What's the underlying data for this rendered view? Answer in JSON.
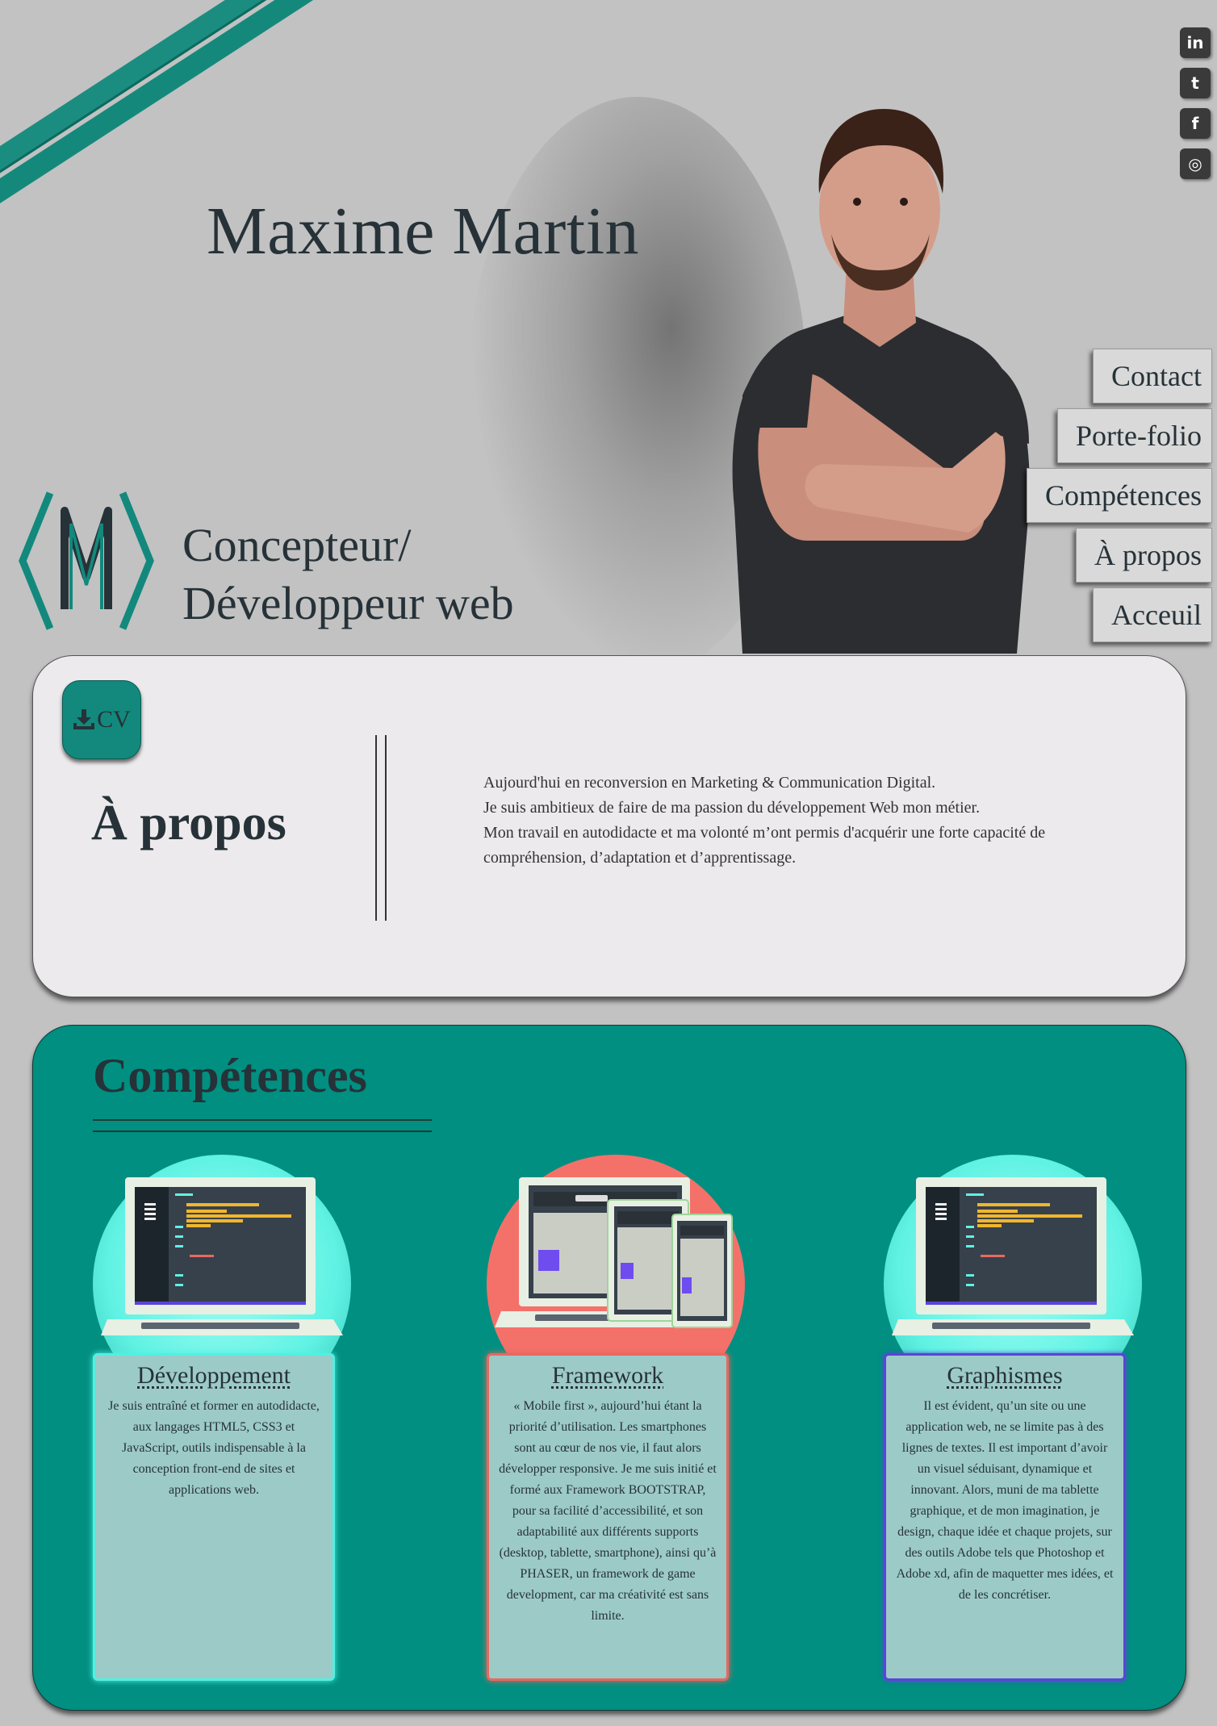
{
  "header": {
    "name": "Maxime Martin",
    "subtitle_line1": "Concepteur/",
    "subtitle_line2": "Développeur web"
  },
  "social": [
    {
      "icon": "linkedin-icon",
      "glyph": "in"
    },
    {
      "icon": "twitter-icon",
      "glyph": "t"
    },
    {
      "icon": "facebook-icon",
      "glyph": "f"
    },
    {
      "icon": "instagram-icon",
      "glyph": "◎"
    }
  ],
  "nav": [
    "Contact",
    "Porte-folio",
    "Compétences",
    "À propos",
    "Acceuil"
  ],
  "about": {
    "cv_label": "CV",
    "title": "À propos",
    "lines": [
      "Aujourd'hui en reconversion en Marketing & Communication Digital.",
      "Je suis ambitieux de faire de ma passion du développement Web mon métier.",
      "Mon travail en autodidacte et ma volonté m’ont permis d'acquérir une forte capacité de compréhension, d’adaptation et d’apprentissage."
    ]
  },
  "skills": {
    "title": "Compétences",
    "items": [
      {
        "title": "Développement",
        "text": "Je suis entraîné et former en autodidacte, aux langages HTML5, CSS3 et JavaScript, outils indispensable à la conception front-end de sites et applications web."
      },
      {
        "title": "Framework",
        "text": "« Mobile first », aujourd’hui étant la priorité d’utilisation. Les smartphones sont au cœur de nos vie, il faut alors développer responsive. Je me suis initié et formé aux Framework BOOTSTRAP, pour sa facilité d’accessibilité, et son adaptabilité aux différents supports (desktop, tablette, smartphone), ainsi qu’à PHASER, un framework de game development, car ma créativité est sans limite."
      },
      {
        "title": "Graphismes",
        "text": "Il est évident, qu’un site ou une application web, ne se limite pas à des lignes de textes. Il est important d’avoir un visuel séduisant, dynamique et innovant. Alors, muni de ma tablette graphique, et de mon imagination, je design, chaque idée et chaque projets, sur des outils Adobe tels que Photoshop et Adobe xd, afin de maquetter mes idées, et de les concrétiser."
      }
    ]
  },
  "colors": {
    "background": "#c2c2c2",
    "accent": "#008f81",
    "circle_dev": "#5ff2e3",
    "circle_framework": "#f4716a",
    "border_dev": "#52f0e0",
    "border_framework": "#e8685f",
    "border_graph": "#5b44d8"
  }
}
